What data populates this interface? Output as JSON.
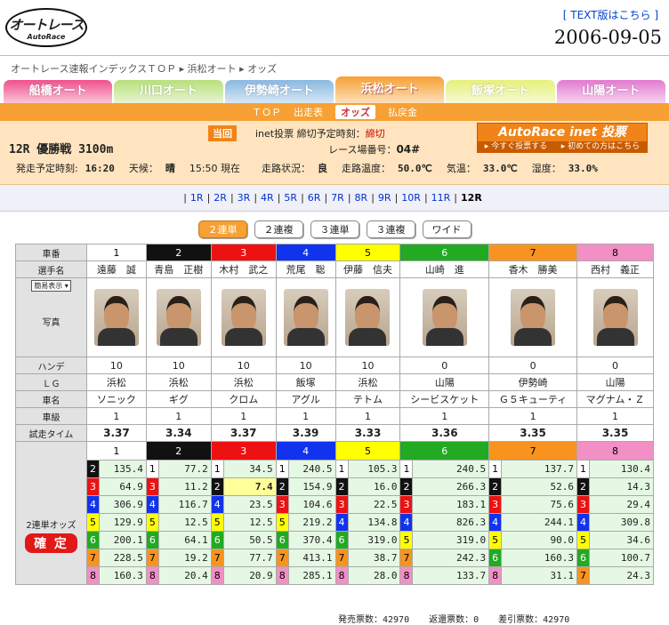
{
  "header": {
    "logo_main": "オートレース",
    "logo_sub": "AutoRace",
    "text_link": "[ TEXT版はこちら ]",
    "date": "2006-09-05"
  },
  "breadcrumb": {
    "top": "オートレース速報インデックスＴＯＰ",
    "sep": "▸",
    "venue": "浜松オート",
    "page": "オッズ"
  },
  "tabs": [
    {
      "label": "船橋オート",
      "color": "#f0508c",
      "active": false
    },
    {
      "label": "川口オート",
      "color": "#b8e07a",
      "active": false
    },
    {
      "label": "伊勢崎オート",
      "color": "#8ab8e0",
      "active": false
    },
    {
      "label": "浜松オート",
      "color": "#f7a033",
      "active": true
    },
    {
      "label": "飯塚オート",
      "color": "#e6f07a",
      "active": false
    },
    {
      "label": "山陽オート",
      "color": "#e37ad0",
      "active": false
    }
  ],
  "subnav": [
    "ＴＯＰ",
    "出走表",
    "オッズ",
    "払戻金"
  ],
  "subnav_active": "オッズ",
  "info": {
    "race": "12R 優勝戦 3100m",
    "tokai": "当回",
    "inet_label": "inet投票 締切予定時刻：",
    "inet_status": "締切",
    "venue_label": "レース場番号：",
    "venue_no": "04#",
    "banner_title": "AutoRace inet 投票",
    "banner_left": "▸ 今すぐ投票する",
    "banner_right": "▸ 初めての方はこちら",
    "weather": [
      {
        "k": "発走予定時刻:",
        "v": "16:20"
      },
      {
        "k": "天候：",
        "v": "晴"
      },
      {
        "k": "15:50 現在",
        "v": ""
      },
      {
        "k": "走路状況：",
        "v": "良"
      },
      {
        "k": "走路温度：",
        "v": "50.0℃"
      },
      {
        "k": "気温：",
        "v": "33.0℃"
      },
      {
        "k": "湿度：",
        "v": "33.0%"
      }
    ]
  },
  "races": [
    "1R",
    "2R",
    "3R",
    "4R",
    "5R",
    "6R",
    "7R",
    "8R",
    "9R",
    "10R",
    "11R",
    "12R"
  ],
  "current_race": "12R",
  "bet_types": [
    "２連単",
    "２連複",
    "３連単",
    "３連複",
    "ワイド"
  ],
  "bet_active": "２連単",
  "labels": {
    "car": "車番",
    "rider": "選手名",
    "select": "簡易表示 ▾",
    "photo": "写真",
    "handi": "ハンデ",
    "lg": "ＬＧ",
    "bike": "車名",
    "class": "車級",
    "trial": "試走タイム",
    "odds_label": "2連単オッズ",
    "kakutei": "確 定"
  },
  "colors": {
    "bg": [
      "#ffffff",
      "#111111",
      "#ee1111",
      "#1133ee",
      "#ffff00",
      "#22aa22",
      "#f7931e",
      "#f28fc4"
    ],
    "fg": [
      "#000",
      "#fff",
      "#fff",
      "#fff",
      "#000",
      "#fff",
      "#000",
      "#000"
    ]
  },
  "riders": [
    {
      "no": "1",
      "name": "遠藤　誠",
      "handi": "10",
      "lg": "浜松",
      "bike": "ソニック",
      "class": "1",
      "trial": "3.37"
    },
    {
      "no": "2",
      "name": "青島　正樹",
      "handi": "10",
      "lg": "浜松",
      "bike": "ギグ",
      "class": "1",
      "trial": "3.34"
    },
    {
      "no": "3",
      "name": "木村　武之",
      "handi": "10",
      "lg": "浜松",
      "bike": "クロム",
      "class": "1",
      "trial": "3.37"
    },
    {
      "no": "4",
      "name": "荒尾　聡",
      "handi": "10",
      "lg": "飯塚",
      "bike": "アグル",
      "class": "1",
      "trial": "3.39"
    },
    {
      "no": "5",
      "name": "伊藤　信夫",
      "handi": "10",
      "lg": "浜松",
      "bike": "テトム",
      "class": "1",
      "trial": "3.33"
    },
    {
      "no": "6",
      "name": "山崎　進",
      "handi": "0",
      "lg": "山陽",
      "bike": "シービスケット",
      "class": "1",
      "trial": "3.36"
    },
    {
      "no": "7",
      "name": "香木　勝美",
      "handi": "0",
      "lg": "伊勢崎",
      "bike": "Ｇ５キューティ",
      "class": "1",
      "trial": "3.35"
    },
    {
      "no": "8",
      "name": "西村　義正",
      "handi": "0",
      "lg": "山陽",
      "bike": "マグナム・Ｚ",
      "class": "1",
      "trial": "3.35"
    }
  ],
  "odds": [
    [
      [
        "2",
        "135.4"
      ],
      [
        "3",
        "64.9"
      ],
      [
        "4",
        "306.9"
      ],
      [
        "5",
        "129.9"
      ],
      [
        "6",
        "200.1"
      ],
      [
        "7",
        "228.5"
      ],
      [
        "8",
        "160.3"
      ]
    ],
    [
      [
        "1",
        "77.2"
      ],
      [
        "3",
        "11.2"
      ],
      [
        "4",
        "116.7"
      ],
      [
        "5",
        "12.5"
      ],
      [
        "6",
        "64.1"
      ],
      [
        "7",
        "19.2"
      ],
      [
        "8",
        "20.4"
      ]
    ],
    [
      [
        "1",
        "34.5"
      ],
      [
        "2",
        "7.4"
      ],
      [
        "4",
        "23.5"
      ],
      [
        "5",
        "12.5"
      ],
      [
        "6",
        "50.5"
      ],
      [
        "7",
        "77.7"
      ],
      [
        "8",
        "20.9"
      ]
    ],
    [
      [
        "1",
        "240.5"
      ],
      [
        "2",
        "154.9"
      ],
      [
        "3",
        "104.6"
      ],
      [
        "5",
        "219.2"
      ],
      [
        "6",
        "370.4"
      ],
      [
        "7",
        "413.1"
      ],
      [
        "8",
        "285.1"
      ]
    ],
    [
      [
        "1",
        "105.3"
      ],
      [
        "2",
        "16.0"
      ],
      [
        "3",
        "22.5"
      ],
      [
        "4",
        "134.8"
      ],
      [
        "6",
        "319.0"
      ],
      [
        "7",
        "38.7"
      ],
      [
        "8",
        "28.0"
      ]
    ],
    [
      [
        "1",
        "240.5"
      ],
      [
        "2",
        "266.3"
      ],
      [
        "3",
        "183.1"
      ],
      [
        "4",
        "826.3"
      ],
      [
        "5",
        "319.0"
      ],
      [
        "7",
        "242.3"
      ],
      [
        "8",
        "133.7"
      ]
    ],
    [
      [
        "1",
        "137.7"
      ],
      [
        "2",
        "52.6"
      ],
      [
        "3",
        "75.6"
      ],
      [
        "4",
        "244.1"
      ],
      [
        "5",
        "90.0"
      ],
      [
        "6",
        "160.3"
      ],
      [
        "8",
        "31.1"
      ]
    ],
    [
      [
        "1",
        "130.4"
      ],
      [
        "2",
        "14.3"
      ],
      [
        "3",
        "29.4"
      ],
      [
        "4",
        "309.8"
      ],
      [
        "5",
        "34.6"
      ],
      [
        "6",
        "100.7"
      ],
      [
        "7",
        "24.3"
      ]
    ]
  ],
  "odds_highlight": "7.4",
  "footer": {
    "sales_label": "発売票数：",
    "sales": "42970",
    "refund_label": "返還票数：",
    "refund": "0",
    "net_label": "差引票数：",
    "net": "42970"
  }
}
